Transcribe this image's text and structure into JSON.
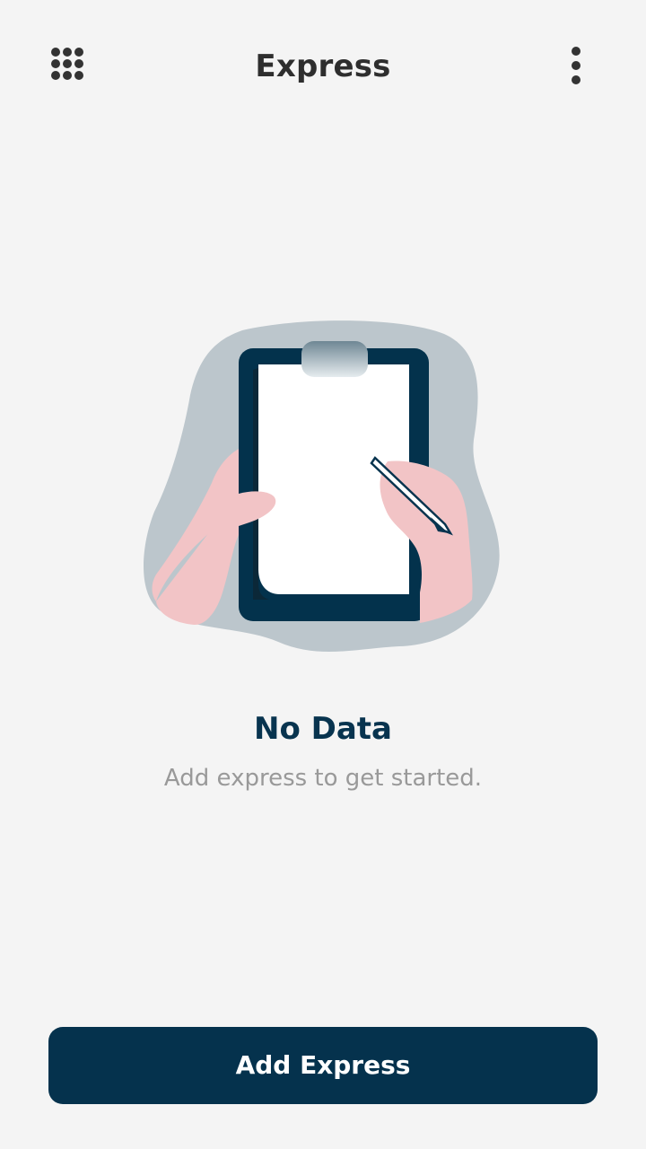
{
  "header": {
    "title": "Express",
    "left_icon": "apps-grid-icon",
    "right_icon": "more-vertical-icon"
  },
  "empty_state": {
    "illustration": "clipboard-writing-illustration",
    "title": "No Data",
    "subtitle": "Add express to get started."
  },
  "footer": {
    "add_button_label": "Add Express"
  },
  "colors": {
    "background": "#f4f4f4",
    "primary": "#05324d",
    "title_text": "#2e2e2e",
    "subtitle_text": "#999999",
    "blob": "#bcc6cc",
    "skin": "#f2c4c6"
  }
}
